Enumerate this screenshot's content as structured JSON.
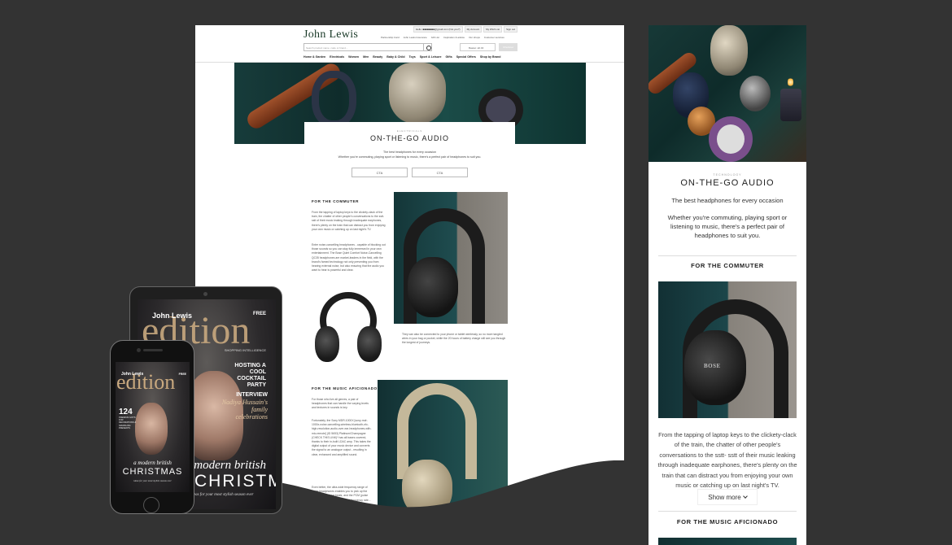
{
  "desktop": {
    "logo": "John Lewis",
    "top_links": [
      "Hello: ■■■■■■■■@gmail.com (Not you?)",
      "My Account",
      "My Wish List",
      "Sign out"
    ],
    "sub_links": [
      "Partnership Card",
      "John Lewis Insurance",
      "Gift List",
      "Inspiration & advice",
      "Our shops",
      "Customer services"
    ],
    "search_placeholder": "Search product name, code or brand...",
    "basket_label": "Basket: £0.00",
    "checkout_label": "Checkout",
    "categories": [
      "Home & Garden",
      "Electricals",
      "Women",
      "Men",
      "Beauty",
      "Baby & Child",
      "Toys",
      "Sport & Leisure",
      "Gifts",
      "Special Offers",
      "Shop by Brand"
    ],
    "eyebrow": "ELECTRICALS",
    "title": "ON-THE-GO AUDIO",
    "desc1": "The best headphones for every occasion",
    "desc2": "Whether you're commuting, playing sport or listening to music, there's a perfect pair of headphones to suit you.",
    "cta1": "CTA",
    "cta2": "CTA",
    "commuter_title": "FOR THE COMMUTER",
    "commuter_p1": "From the tapping of laptop keys to the clickety-clack of the train, the chatter of other people's conversations to the sstt- sstt of their music leaking through inadequate earphones, there's plenty on the train that can distract you from enjoying your own music or catching up on last night's TV.",
    "commuter_p2": "Enter noise-cancelling headphones - capable of blocking out those sounds so you can stay fully immersed in your own entertainment. The Bose Quiet Comfort Noise-Cancelling QC35 headphones are market-leaders in the field, with the brand's famed technology not only preventing you from hearing external noise, but also ensuring that the audio you want to hear is powerful and clear.",
    "commuter_p3": "They can also be connected to your phone or tablet wirelessly, so no more tangled wires in your bag or pocket, while the 20 hours of battery charge will see you through the longest of journeys.",
    "music_title": "FOR THE MUSIC AFICIONADO",
    "music_p1": "For those who live all genres, a pair of headphones that can handle the varying levels and textures in sounds is key.",
    "music_p2": "Fortunately, the Sony MDR-1000X [sony-mdr-1000x-noise-cancelling-wireless-bluetooth-nfc-high-resolution-audio-over-ear-headphones-with-mic-remote] (ID 5653) Platinum/Champagne (CHECK THIS LINK)* has all bases covered, thanks to their in-built LDAC amp. This takes the digital output of your music device and converts the signal to an analogue output - resulting in clear, enhanced and amplified sound.",
    "music_p3": "Even better, the ultra-wide frequency range of these headphones enables you to pick up the lowest and highest beats, and the PCM (pulse code modulation) sampling and frequency rate..."
  },
  "tablet": {
    "brand": "John Lewis",
    "masthead": "edition",
    "free": "FREE",
    "intelligence": "SHOPPING INTELLIGENCE",
    "hosting": "HOSTING A COOL COCKTAIL PARTY",
    "interview": "INTERVIEW",
    "interview_sub": "Nadiya Hussain's family celebrations",
    "modern": "a modern british",
    "christmas": "CHRISTMAS",
    "ideas": "ideas for your most stylish season ever"
  },
  "phone": {
    "brand": "John Lewis",
    "masthead": "edition",
    "free": "FREE",
    "number": "124",
    "gifts": "PREMIUM GIFTS FOR DECORATIONS & SPARKLING PRESENTS",
    "modern": "a modern british",
    "christmas": "CHRISTMAS",
    "ideas": "ideas for your most stylish season ever"
  },
  "mobile": {
    "eyebrow": "TECHNOLOGY",
    "title": "ON-THE-GO AUDIO",
    "sub": "The best headphones for every occasion",
    "body": "Whether you're commuting, playing sport or listening to music, there's a perfect pair of headphones to suit you.",
    "commuter_title": "FOR THE COMMUTER",
    "photo_logo": "BOSE",
    "para": "From the tapping of laptop keys to the clickety-clack of the train, the chatter of other people's conversations to the sstt- sstt of their music leaking through inadequate earphones, there's plenty on the train that can distract you from enjoying your own music or catching up on last night's TV.",
    "show_more": "Show more",
    "music_title": "FOR THE MUSIC AFICIONADO"
  }
}
